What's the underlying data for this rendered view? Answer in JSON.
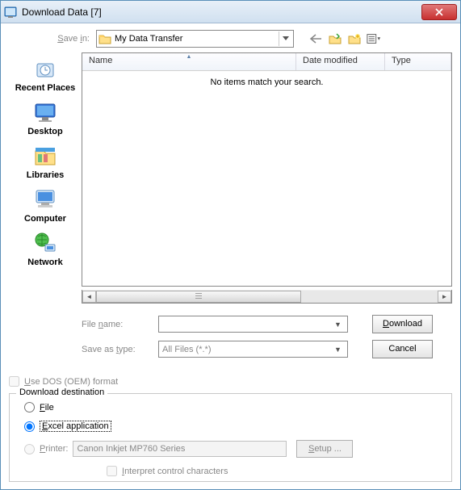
{
  "title": "Download Data [7]",
  "save_in_label": "Save in:",
  "save_in_value": "My Data Transfer",
  "columns": {
    "name": "Name",
    "date": "Date modified",
    "type": "Type"
  },
  "empty_message": "No items match your search.",
  "places": {
    "recent": "Recent Places",
    "desktop": "Desktop",
    "libraries": "Libraries",
    "computer": "Computer",
    "network": "Network"
  },
  "file_name_label": "File name:",
  "file_name_value": "",
  "save_type_label": "Save as type:",
  "save_type_value": "All Files (*.*)",
  "download_btn": "Download",
  "cancel_btn": "Cancel",
  "use_dos_label": "Use DOS (OEM) format",
  "destination_legend": "Download destination",
  "dest_file": "File",
  "dest_excel": "Excel application",
  "dest_printer": "Printer:",
  "printer_value": "Canon Inkjet MP760 Series",
  "setup_btn": "Setup ...",
  "interpret_label": "Interpret control characters"
}
